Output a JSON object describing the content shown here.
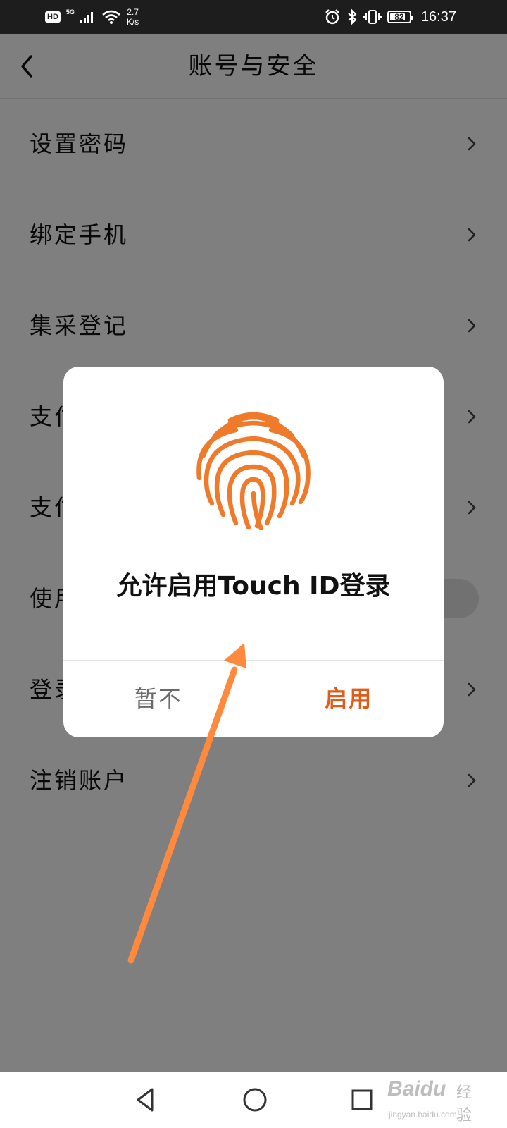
{
  "status_bar": {
    "hd": "HD",
    "network": "5G",
    "speed_value": "2.7",
    "speed_unit": "K/s",
    "battery": "82",
    "battery_level": 0.82,
    "time": "16:37"
  },
  "header": {
    "title": "账号与安全",
    "back_icon": "chevron-left-icon"
  },
  "settings": {
    "items": [
      {
        "label": "设置密码",
        "control": "chevron"
      },
      {
        "label": "绑定手机",
        "control": "chevron"
      },
      {
        "label": "集采登记",
        "control": "chevron"
      },
      {
        "label": "支付",
        "control": "chevron"
      },
      {
        "label": "支付",
        "control": "chevron"
      },
      {
        "label": "使用",
        "control": "toggle"
      },
      {
        "label": "登录",
        "control": "chevron"
      },
      {
        "label": "注销账户",
        "control": "chevron"
      }
    ]
  },
  "dialog": {
    "icon": "fingerprint-icon",
    "title": "允许启用Touch ID登录",
    "cancel_label": "暂不",
    "confirm_label": "启用"
  },
  "colors": {
    "accent": "#e05c1a",
    "fingerprint": "#ee7a2a",
    "arrow": "#ff8a3d",
    "overlay": "#000000"
  },
  "nav_bar": {
    "back_icon": "triangle-back-icon",
    "home_icon": "circle-home-icon",
    "recent_icon": "square-recent-icon"
  },
  "watermark": {
    "logo": "Baidu",
    "sub": "经验",
    "url": "jingyan.baidu.com"
  }
}
